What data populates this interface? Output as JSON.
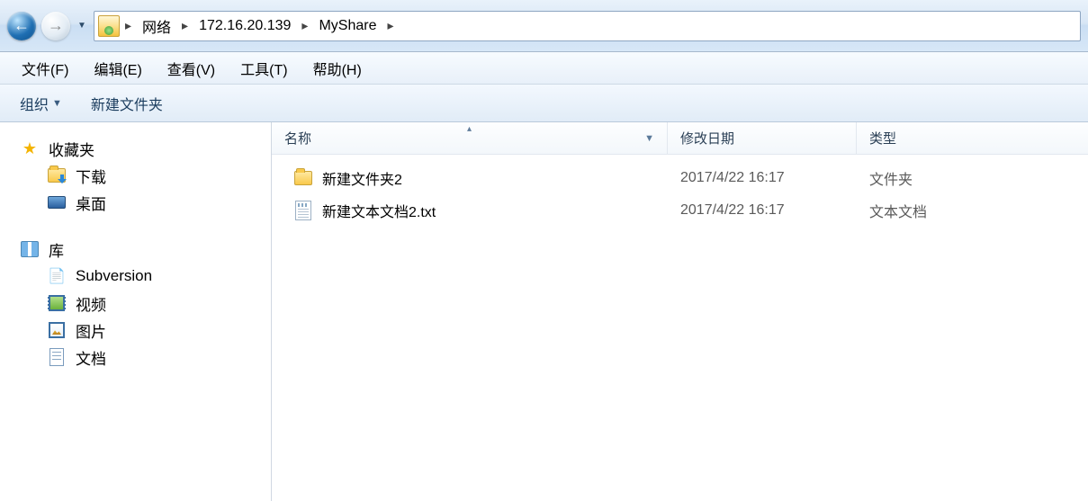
{
  "breadcrumb": {
    "root": "网络",
    "host": "172.16.20.139",
    "share": "MyShare"
  },
  "menu": {
    "file": "文件(F)",
    "edit": "编辑(E)",
    "view": "查看(V)",
    "tools": "工具(T)",
    "help": "帮助(H)"
  },
  "toolbar": {
    "organize": "组织",
    "new_folder": "新建文件夹"
  },
  "sidebar": {
    "favorites": {
      "header": "收藏夹",
      "items": [
        {
          "label": "下载"
        },
        {
          "label": "桌面"
        }
      ]
    },
    "libraries": {
      "header": "库",
      "items": [
        {
          "label": "Subversion"
        },
        {
          "label": "视频"
        },
        {
          "label": "图片"
        },
        {
          "label": "文档"
        }
      ]
    }
  },
  "columns": {
    "name": "名称",
    "modified": "修改日期",
    "type": "类型"
  },
  "files": [
    {
      "name": "新建文件夹2",
      "date": "2017/4/22 16:17",
      "type": "文件夹",
      "icon": "folder"
    },
    {
      "name": "新建文本文档2.txt",
      "date": "2017/4/22 16:17",
      "type": "文本文档",
      "icon": "txt"
    }
  ]
}
